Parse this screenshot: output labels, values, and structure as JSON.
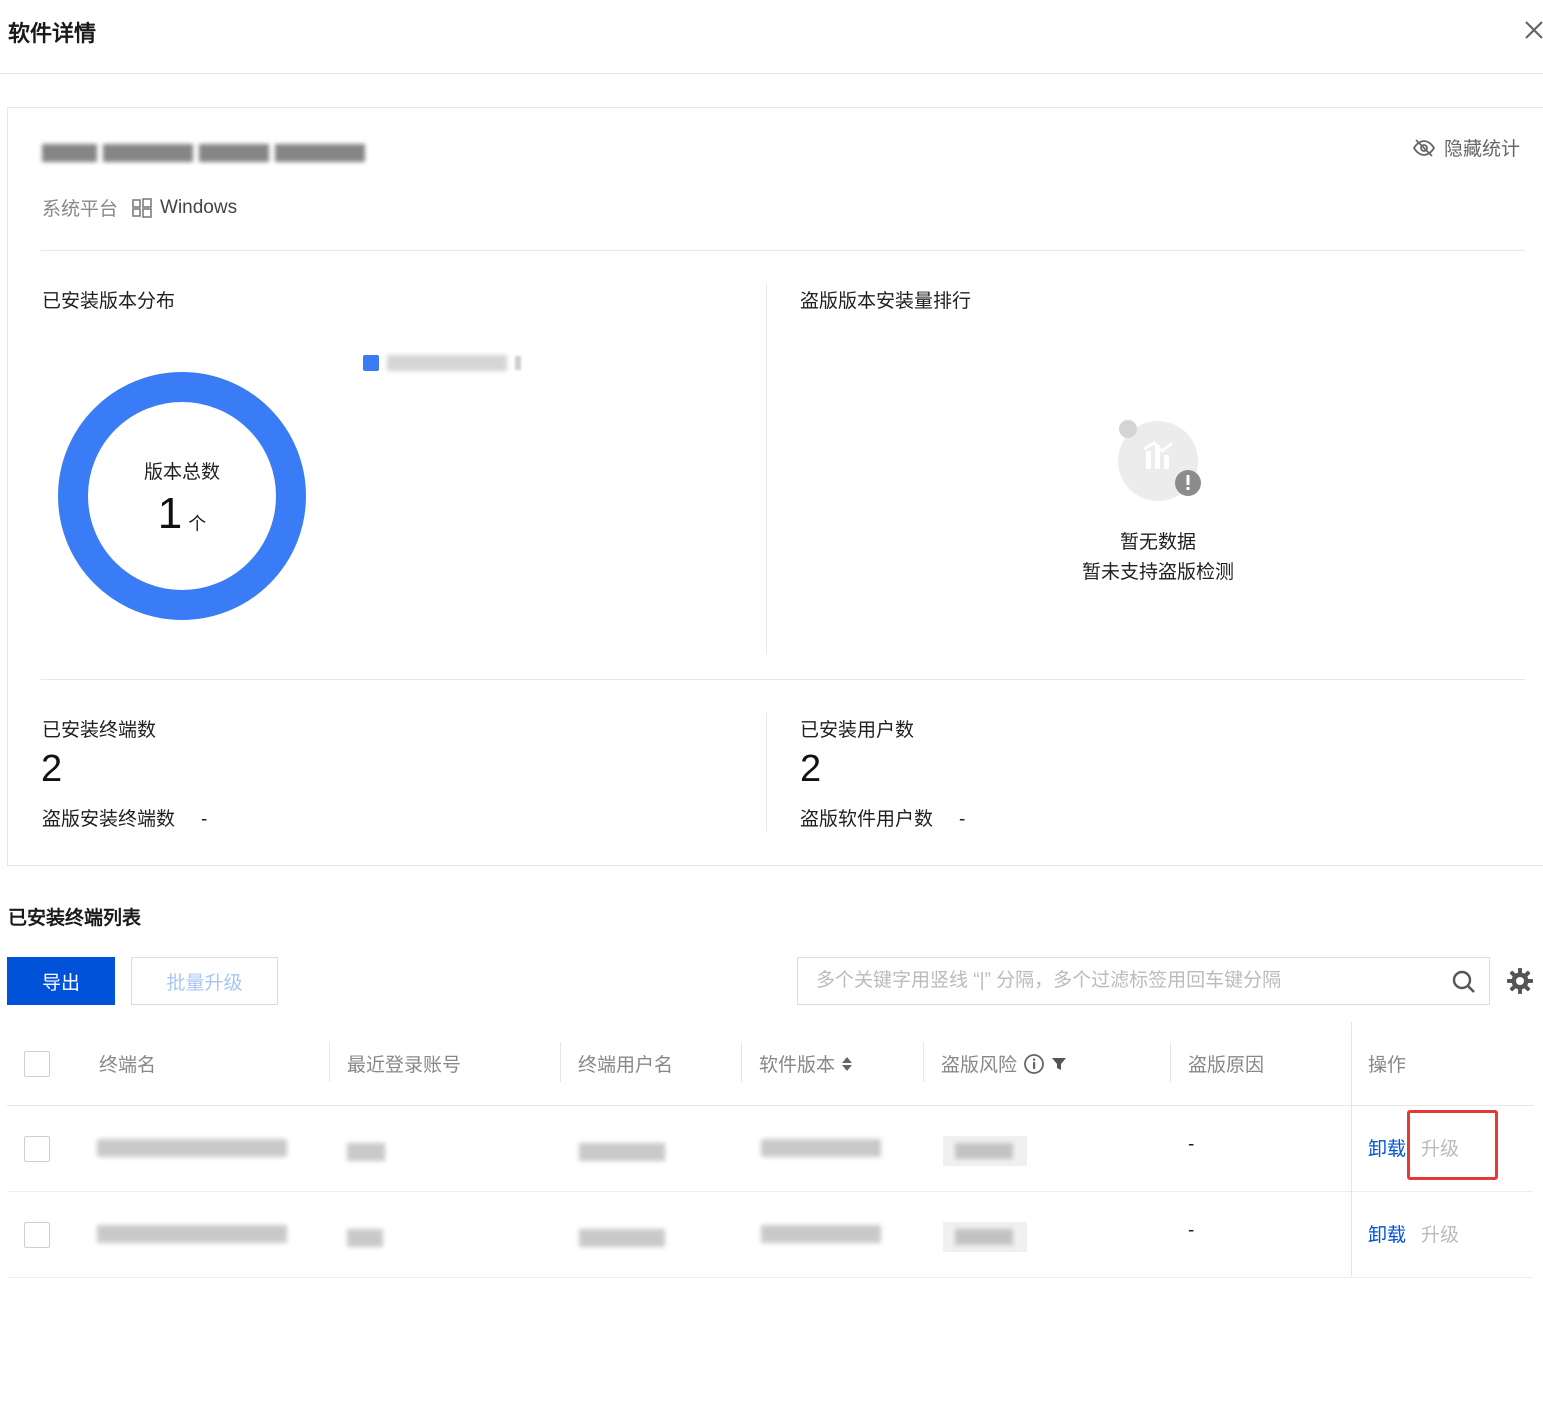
{
  "dialog": {
    "title": "软件详情"
  },
  "software": {
    "platform_label": "系统平台",
    "platform_value": "Windows",
    "hide_stats_label": "隐藏统计"
  },
  "distribution": {
    "title": "已安装版本分布",
    "center_label": "版本总数",
    "total": "1",
    "unit": "个",
    "chart_color": "#3a7cf6"
  },
  "piracy_ranking": {
    "title": "盗版版本安装量排行",
    "empty_title": "暂无数据",
    "empty_subtitle": "暂未支持盗版检测"
  },
  "stats": {
    "terminals_label": "已安装终端数",
    "terminals_value": "2",
    "pirated_terminals_label": "盗版安装终端数",
    "pirated_terminals_value": "-",
    "users_label": "已安装用户数",
    "users_value": "2",
    "pirated_users_label": "盗版软件用户数",
    "pirated_users_value": "-"
  },
  "list": {
    "title": "已安装终端列表",
    "export_label": "导出",
    "batch_upgrade_label": "批量升级",
    "search_placeholder": "多个关键字用竖线 “|” 分隔，多个过滤标签用回车键分隔",
    "columns": [
      "终端名",
      "最近登录账号",
      "终端用户名",
      "软件版本",
      "盗版风险",
      "盗版原因",
      "操作"
    ],
    "rows": [
      {
        "reason": "-",
        "uninstall": "卸载",
        "upgrade": "升级"
      },
      {
        "reason": "-",
        "uninstall": "卸载",
        "upgrade": "升级"
      }
    ]
  },
  "colors": {
    "primary": "#0052d9",
    "highlight": "#e53935"
  }
}
